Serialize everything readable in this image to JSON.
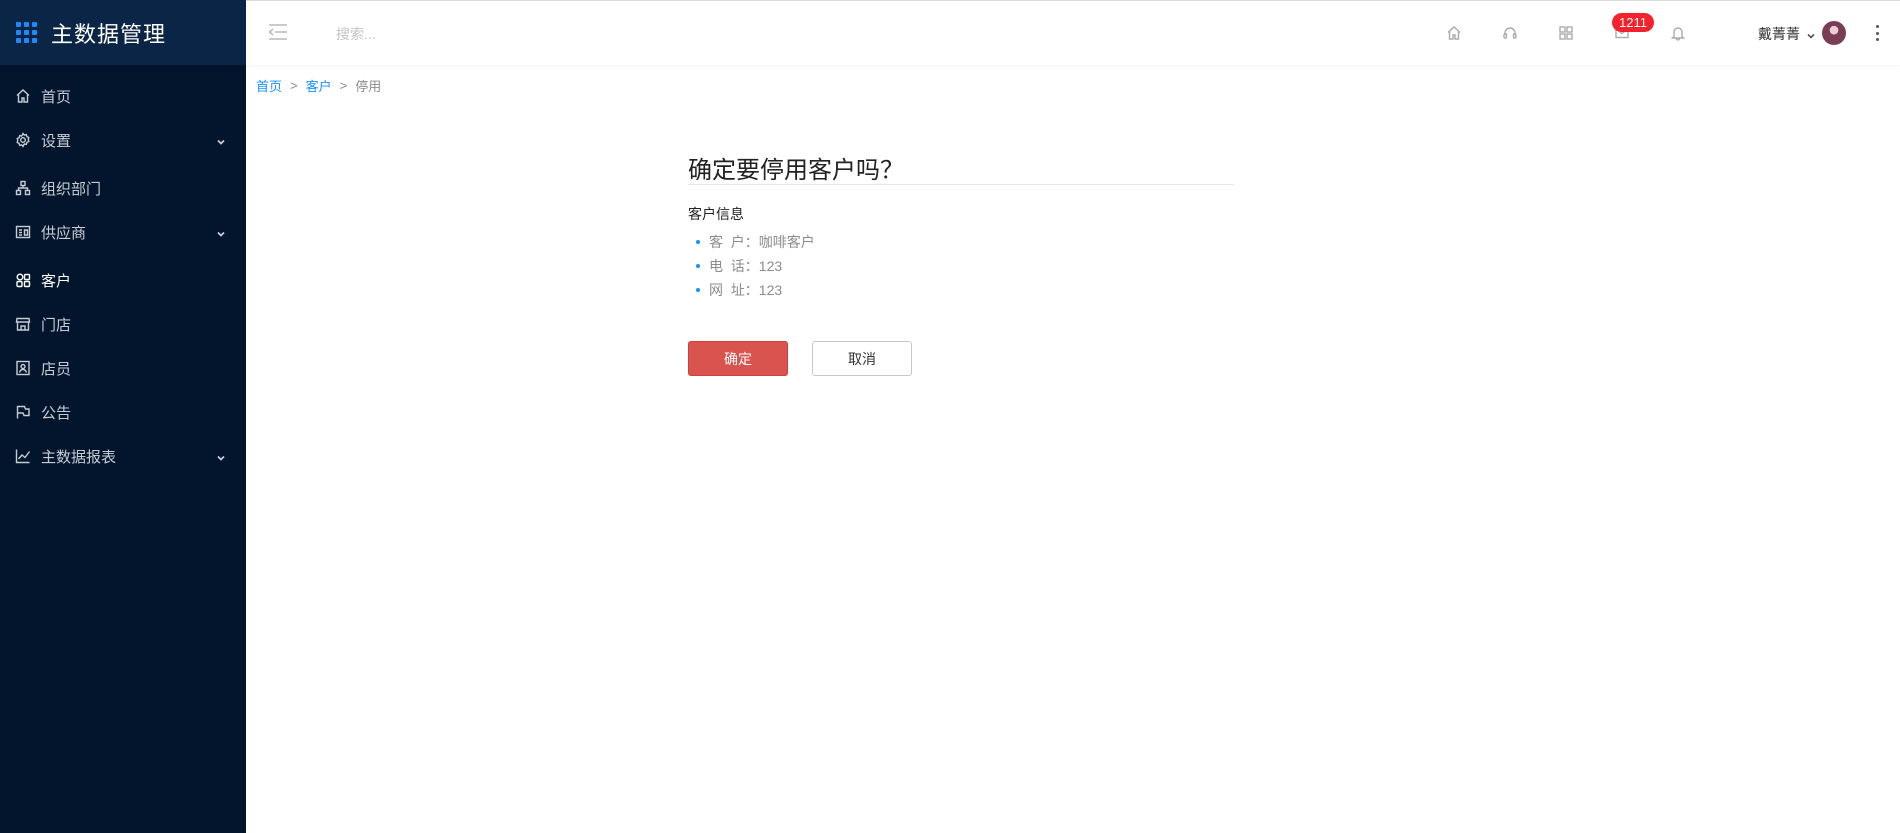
{
  "app": {
    "title": "主数据管理"
  },
  "sidebar": {
    "items": [
      {
        "label": "首页",
        "icon": "home-icon",
        "has_children": false,
        "active": false
      },
      {
        "label": "设置",
        "icon": "gear-icon",
        "has_children": true,
        "active": false
      },
      {
        "label": "组织部门",
        "icon": "org-chart-icon",
        "has_children": false,
        "active": false
      },
      {
        "label": "供应商",
        "icon": "vendor-card-icon",
        "has_children": true,
        "active": false
      },
      {
        "label": "客户",
        "icon": "customer-icon",
        "has_children": false,
        "active": true
      },
      {
        "label": "门店",
        "icon": "store-icon",
        "has_children": false,
        "active": false
      },
      {
        "label": "店员",
        "icon": "staff-badge-icon",
        "has_children": false,
        "active": false
      },
      {
        "label": "公告",
        "icon": "flag-icon",
        "has_children": false,
        "active": false
      },
      {
        "label": "主数据报表",
        "icon": "line-chart-icon",
        "has_children": true,
        "active": false
      }
    ]
  },
  "topbar": {
    "search_placeholder": "搜索...",
    "notification_count": "1211",
    "user_name": "戴菁菁"
  },
  "breadcrumb": {
    "items": [
      "首页",
      "客户"
    ],
    "current": "停用",
    "separator": ">"
  },
  "confirm": {
    "title": "确定要停用客户吗？",
    "section_label": "客户信息",
    "fields": [
      "客  户：咖啡客户",
      "电  话：123",
      "网  址：123"
    ],
    "confirm_label": "确定",
    "cancel_label": "取消"
  },
  "colors": {
    "sidebar_bg": "#03152c",
    "brand_bg": "#0a2546",
    "accent": "#1890ff",
    "danger": "#d9534f",
    "badge": "#f5222d"
  }
}
